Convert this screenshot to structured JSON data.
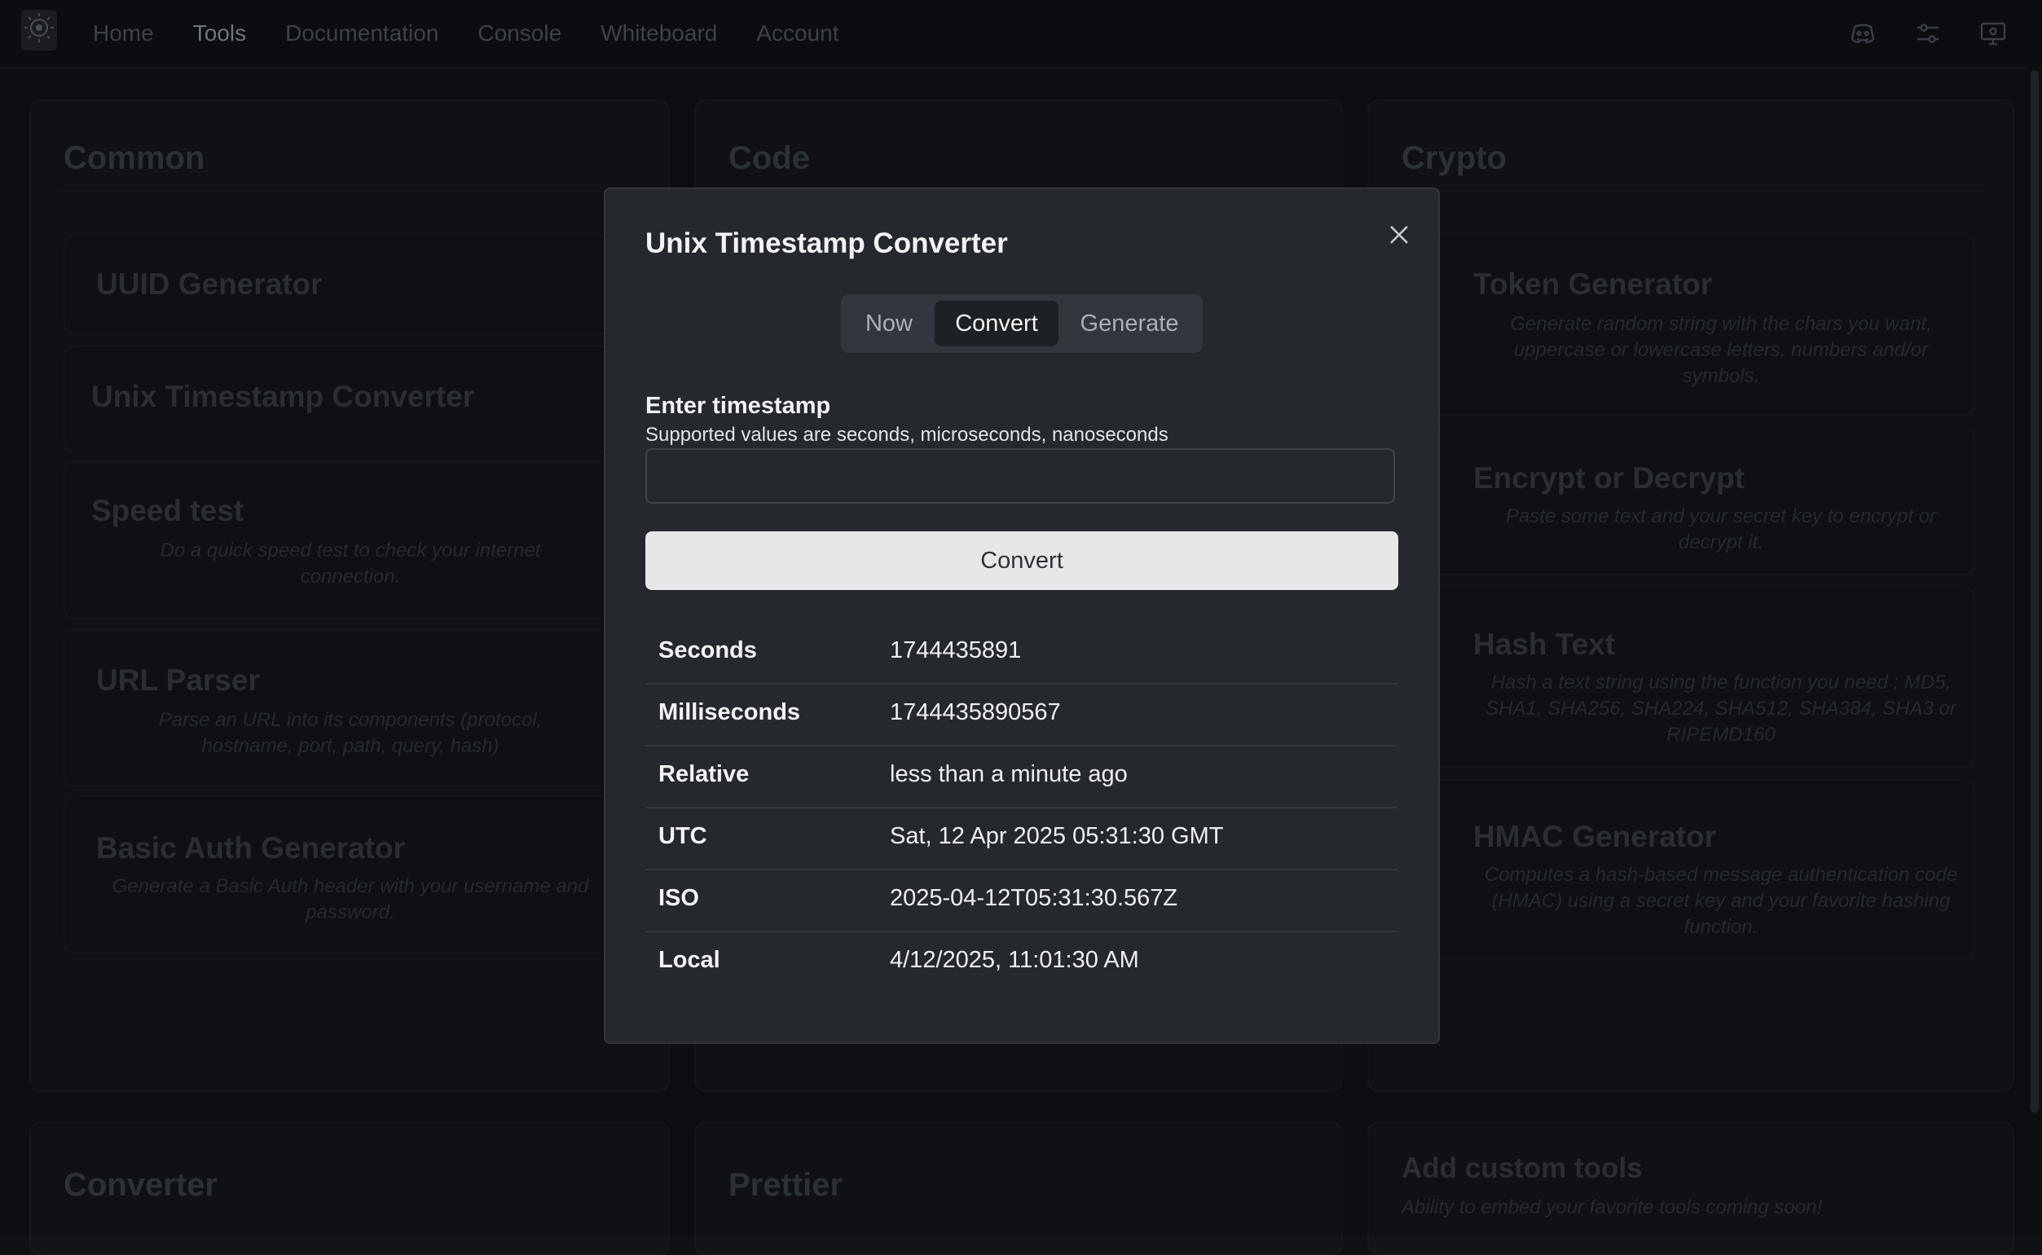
{
  "nav": {
    "items": [
      {
        "label": "Home",
        "active": false
      },
      {
        "label": "Tools",
        "active": true
      },
      {
        "label": "Documentation",
        "active": false
      },
      {
        "label": "Console",
        "active": false
      },
      {
        "label": "Whiteboard",
        "active": false
      },
      {
        "label": "Account",
        "active": false
      }
    ],
    "icons": [
      "discord-icon",
      "sliders-icon",
      "display-settings-icon"
    ]
  },
  "sections": {
    "common": {
      "title": "Common",
      "cards": [
        {
          "title": "UUID Generator",
          "desc": ""
        },
        {
          "title": "Unix Timestamp Converter",
          "desc": ""
        },
        {
          "title": "Speed test",
          "desc": "Do a quick speed test to check your internet connection."
        },
        {
          "title": "URL Parser",
          "desc": "Parse an URL into its components (protocol, hostname, port, path, query, hash)"
        },
        {
          "title": "Basic Auth Generator",
          "desc": "Generate a Basic Auth header with your username and password."
        }
      ]
    },
    "code": {
      "title": "Code"
    },
    "crypto": {
      "title": "Crypto",
      "cards": [
        {
          "title": "Token Generator",
          "desc": "Generate random string with the chars you want, uppercase or lowercase letters, numbers and/or symbols."
        },
        {
          "title": "Encrypt or Decrypt",
          "desc": "Paste some text and your secret key to encrypt or decrypt it."
        },
        {
          "title": "Hash Text",
          "desc": "Hash a text string using the function you need : MD5, SHA1, SHA256, SHA224, SHA512, SHA384, SHA3 or RIPEMD160"
        },
        {
          "title": "HMAC Generator",
          "desc": "Computes a hash-based message authentication code (HMAC) using a secret key and your favorite hashing function."
        }
      ]
    },
    "converter": {
      "title": "Converter"
    },
    "prettier": {
      "title": "Prettier"
    },
    "custom": {
      "title": "Add custom tools",
      "desc": "Ability to embed your favorite tools coming soon!"
    }
  },
  "modal": {
    "title": "Unix Timestamp Converter",
    "tabs": [
      {
        "label": "Now",
        "selected": false
      },
      {
        "label": "Convert",
        "selected": true
      },
      {
        "label": "Generate",
        "selected": false
      }
    ],
    "input_label": "Enter timestamp",
    "input_help": "Supported values are seconds, microseconds, nanoseconds",
    "input_value": "",
    "button_label": "Convert",
    "results": [
      {
        "key": "Seconds",
        "value": "1744435891"
      },
      {
        "key": "Milliseconds",
        "value": "1744435890567"
      },
      {
        "key": "Relative",
        "value": "less than a minute ago"
      },
      {
        "key": "UTC",
        "value": "Sat, 12 Apr 2025 05:31:30 GMT"
      },
      {
        "key": "ISO",
        "value": "2025-04-12T05:31:30.567Z"
      },
      {
        "key": "Local",
        "value": "4/12/2025, 11:01:30 AM"
      }
    ]
  },
  "colors": {
    "background": "#0f1114",
    "modal_bg": "#25282c",
    "button_bg": "#e6e7e9",
    "text_primary": "#f1f3f4"
  }
}
